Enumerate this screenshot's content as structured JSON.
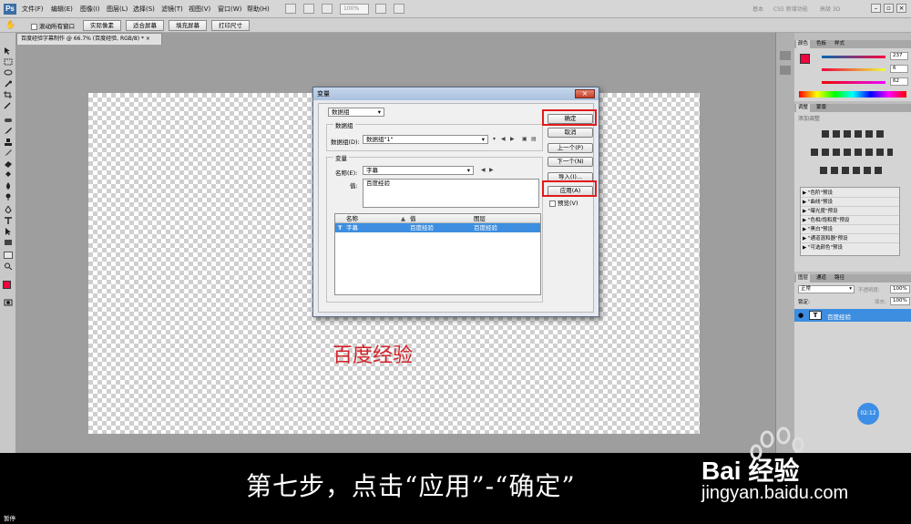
{
  "menubar": {
    "logo": "Ps",
    "items": [
      "文件(F)",
      "编辑(E)",
      "图像(I)",
      "图层(L)",
      "选择(S)",
      "滤镜(T)",
      "视图(V)",
      "窗口(W)",
      "帮助(H)"
    ],
    "zoom": "100%",
    "workspace": [
      "基本",
      "CS5 新增功能",
      "高级 3D"
    ]
  },
  "optbar": {
    "scroll_all_label": "滚动所有窗口",
    "buttons": [
      "实际像素",
      "适合屏幕",
      "填充屏幕",
      "打印尺寸"
    ]
  },
  "document": {
    "tab": "百度经验字幕制作 @ 66.7% (百度经验, RGB/8) *",
    "canvas_text": "百度经验"
  },
  "dialog": {
    "title": "变量",
    "define_select": "数据组",
    "dataset_group_label": "数据组",
    "dataset_label": "数据组(D):",
    "dataset_value": "数据组\"1\"",
    "variables_group_label": "变量",
    "name_label": "名称(E):",
    "name_value": "字幕",
    "value_label": "值:",
    "value_text": "百度经验",
    "table": {
      "headers": [
        "名称",
        "值",
        "图层"
      ],
      "rows": [
        [
          "字幕",
          "百度经验",
          "百度经验"
        ]
      ]
    },
    "buttons": {
      "ok": "确定",
      "cancel": "取消",
      "prev": "上一个(P)",
      "next": "下一个(N)",
      "import": "导入(I)...",
      "apply": "应用(A)",
      "preview": "预览(V)"
    }
  },
  "panels": {
    "color_tabs": [
      "颜色",
      "色板",
      "样式"
    ],
    "rgb_values": [
      "237",
      "6",
      "62"
    ],
    "adjust_tabs": [
      "调整",
      "蒙版"
    ],
    "adjust_title": "添加调整",
    "presets": [
      "\"色阶\"预设",
      "\"曲线\"预设",
      "\"曝光度\"预设",
      "\"色相/饱和度\"预设",
      "\"黑白\"预设",
      "\"通道混和器\"预设",
      "\"可选颜色\"预设"
    ],
    "layers_tabs": [
      "图层",
      "通道",
      "路径"
    ],
    "blend_mode": "正常",
    "opacity_label": "不透明度:",
    "opacity": "100%",
    "lock_label": "锁定:",
    "fill_label": "填充:",
    "fill": "100%",
    "layer_name": "百度经验"
  },
  "overlay": {
    "subtitle": "第七步，点击“应用”-“确定”",
    "watermark_logo": "Bai 经验",
    "watermark_url": "jingyan.baidu.com",
    "timer": "02:12",
    "status": "暂停"
  },
  "colors": {
    "highlight": "#e01b1b",
    "selection": "#3d8ee0",
    "canvas_text": "#d2232a",
    "fg_swatch": "#ed063e"
  }
}
